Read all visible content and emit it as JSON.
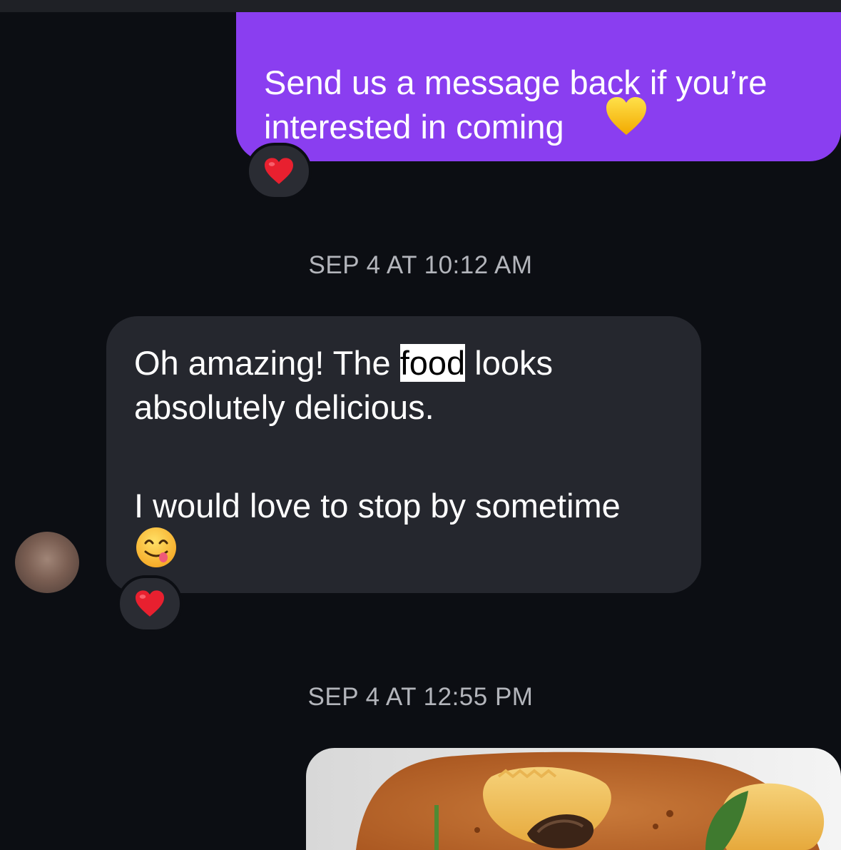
{
  "conversation": {
    "outgoing_message": {
      "text": "Send us a message back if you’re\ninterested in coming",
      "emoji": "yellow-heart-icon",
      "reaction": "red-heart-icon"
    },
    "timestamp_1": "SEP 4 AT 10:12 AM",
    "incoming_message": {
      "line_1_before": "Oh amazing! The ",
      "line_1_highlight": "food",
      "line_1_after": " looks",
      "line_2": "absolutely delicious.",
      "line_3": "I would love to stop by sometime",
      "emoji": "face-savoring-food-icon",
      "reaction": "red-heart-icon"
    },
    "timestamp_2": "SEP 4 AT 12:55 PM",
    "photo_message": {
      "icon": "food-photo"
    }
  },
  "colors": {
    "background": "#0c0e13",
    "outgoing_bubble": "#8a3ef0",
    "incoming_bubble": "#25272e",
    "timestamp_text": "#b3b5bb"
  }
}
